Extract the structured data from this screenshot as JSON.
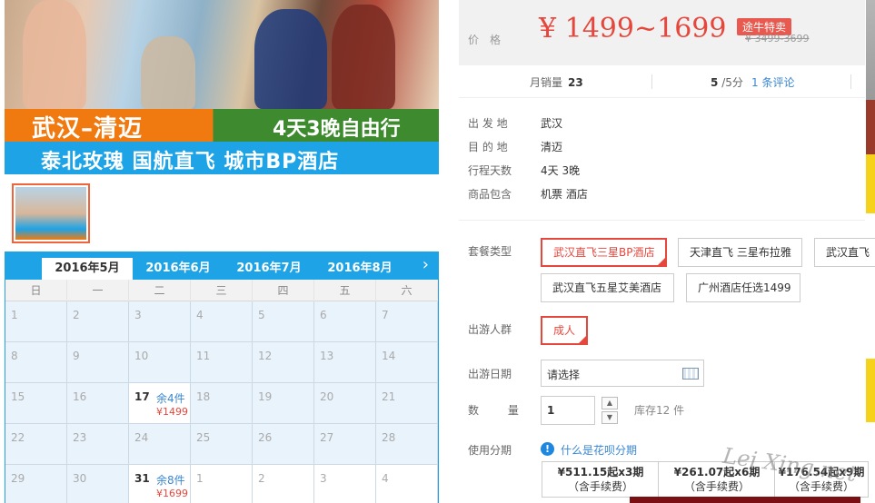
{
  "banner": {
    "title": "武汉–清迈",
    "subtitle": "4天3晚自由行",
    "tagline": "泰北玫瑰  国航直飞  城市BP酒店"
  },
  "calendar": {
    "tabs": [
      "2016年5月",
      "2016年6月",
      "2016年7月",
      "2016年8月"
    ],
    "active_tab": "2016年5月",
    "weekdays": [
      "日",
      "一",
      "二",
      "三",
      "四",
      "五",
      "六"
    ],
    "cells": [
      {
        "day": "1"
      },
      {
        "day": "2"
      },
      {
        "day": "3"
      },
      {
        "day": "4"
      },
      {
        "day": "5"
      },
      {
        "day": "6"
      },
      {
        "day": "7"
      },
      {
        "day": "8"
      },
      {
        "day": "9"
      },
      {
        "day": "10"
      },
      {
        "day": "11"
      },
      {
        "day": "12"
      },
      {
        "day": "13"
      },
      {
        "day": "14"
      },
      {
        "day": "15"
      },
      {
        "day": "16"
      },
      {
        "day": "17",
        "stock": "余4件",
        "price": "¥1499"
      },
      {
        "day": "18"
      },
      {
        "day": "19"
      },
      {
        "day": "20"
      },
      {
        "day": "21"
      },
      {
        "day": "22"
      },
      {
        "day": "23"
      },
      {
        "day": "24"
      },
      {
        "day": "25"
      },
      {
        "day": "26"
      },
      {
        "day": "27"
      },
      {
        "day": "28"
      },
      {
        "day": "29"
      },
      {
        "day": "30"
      },
      {
        "day": "31",
        "stock": "余8件",
        "price": "¥1699"
      },
      {
        "day": "1",
        "out": true
      },
      {
        "day": "2",
        "out": true
      },
      {
        "day": "3",
        "out": true
      },
      {
        "day": "4",
        "out": true
      }
    ]
  },
  "price": {
    "label": "价格",
    "value": "¥ 1499~1699",
    "badge": "途牛特卖",
    "original": "¥ 3499-3699"
  },
  "stats": {
    "sales_label": "月销量",
    "sales_value": "23",
    "score_value": "5",
    "score_suffix": "/5分",
    "reviews": "1 条评论"
  },
  "info": [
    {
      "label": "出 发 地",
      "value": "武汉"
    },
    {
      "label": "目 的 地",
      "value": "清迈"
    },
    {
      "label": "行程天数",
      "value": "4天 3晚"
    },
    {
      "label": "商品包含",
      "value": "机票  酒店"
    }
  ],
  "package": {
    "label": "套餐类型",
    "options": [
      "武汉直飞三星BP酒店",
      "天津直飞 三星布拉雅",
      "武汉直飞",
      "武汉直飞五星艾美酒店",
      "广州酒店任选1499"
    ],
    "selected": "武汉直飞三星BP酒店"
  },
  "group": {
    "label": "出游人群",
    "options": [
      "成人"
    ],
    "selected": "成人"
  },
  "date": {
    "label": "出游日期",
    "placeholder": "请选择"
  },
  "quantity": {
    "label": "数  量",
    "value": "1",
    "stock": "库存12 件"
  },
  "installment": {
    "label": "使用分期",
    "help": "什么是花呗分期",
    "plans": [
      {
        "amount": "¥511.15起x3期",
        "fee": "（含手续费）"
      },
      {
        "amount": "¥261.07起x6期",
        "fee": "（含手续费）"
      },
      {
        "amount": "¥176.54起x9期",
        "fee": "（含手续费）"
      }
    ]
  },
  "watermark": "Lei Xing.net"
}
